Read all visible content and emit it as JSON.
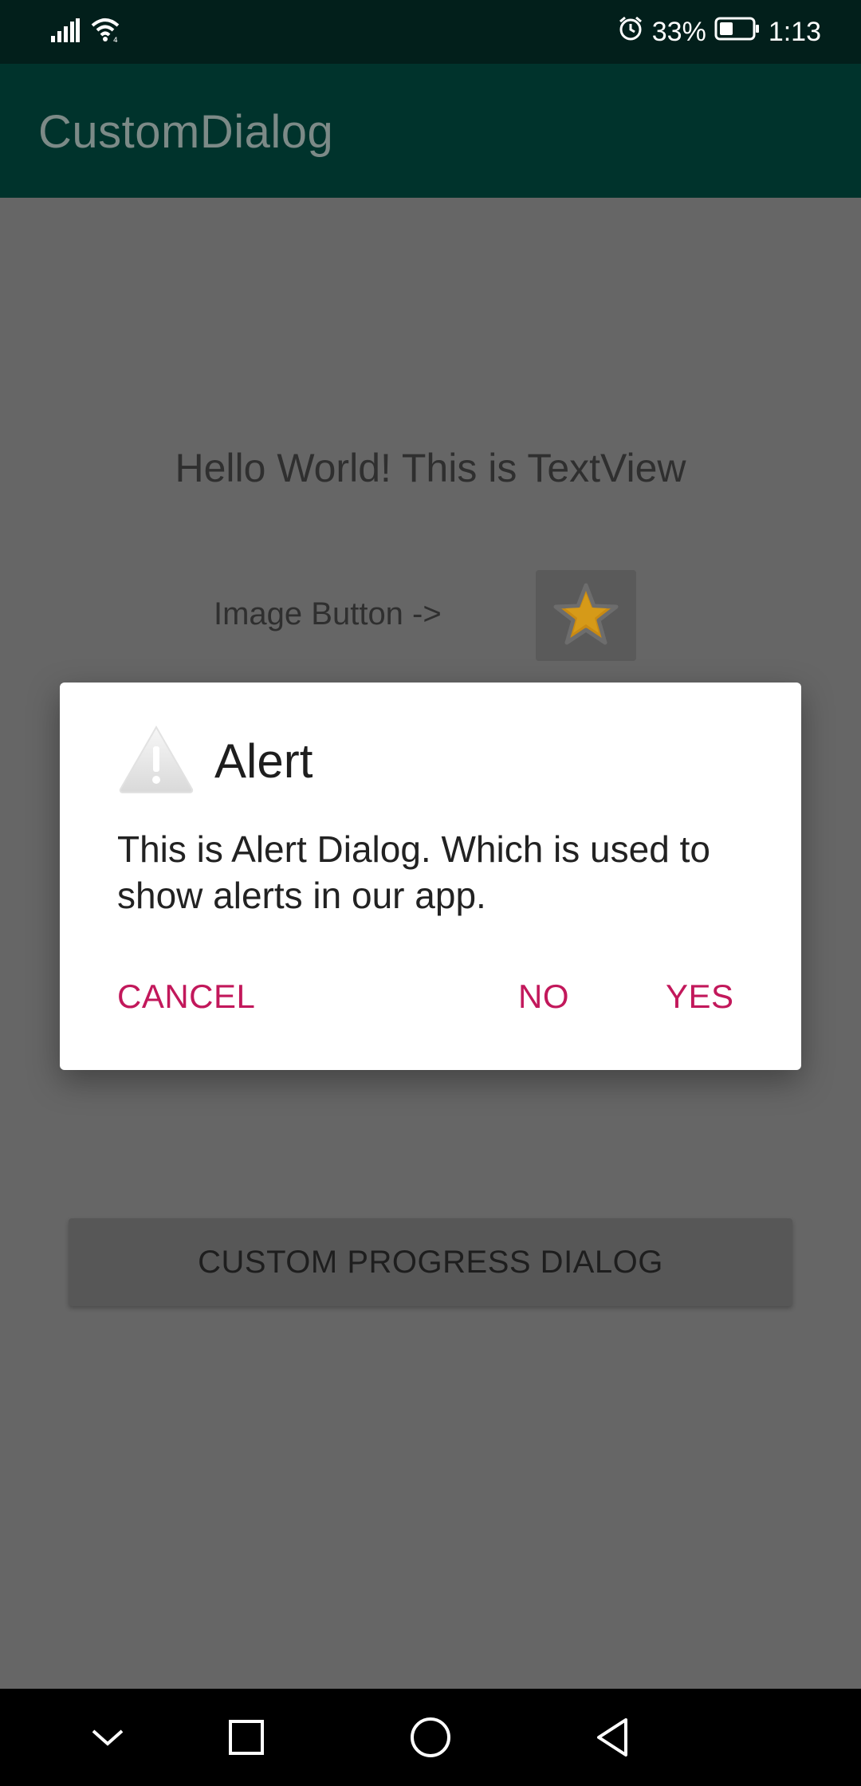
{
  "status_bar": {
    "battery_percent": "33%",
    "time": "1:13",
    "icons": [
      "signal-icon",
      "wifi-icon",
      "alarm-icon",
      "battery-icon"
    ]
  },
  "app_bar": {
    "title": "CustomDialog"
  },
  "content": {
    "hello_text": "Hello World! This is TextView",
    "image_button_label": "Image Button ->",
    "image_button_icon": "star-icon",
    "progress_button_label": "CUSTOM PROGRESS DIALOG"
  },
  "dialog": {
    "icon": "warning-icon",
    "title": "Alert",
    "message": "This is Alert Dialog. Which is used to show alerts in our app.",
    "buttons": {
      "cancel": "CANCEL",
      "no": "NO",
      "yes": "YES"
    },
    "accent_color": "#c2185b"
  },
  "nav_bar": {
    "icons": [
      "chevron-down-icon",
      "recents-square-icon",
      "home-circle-icon",
      "back-triangle-icon"
    ]
  },
  "colors": {
    "status_bar": "#021f1b",
    "app_bar": "#00332c",
    "scrim": "#666666"
  }
}
